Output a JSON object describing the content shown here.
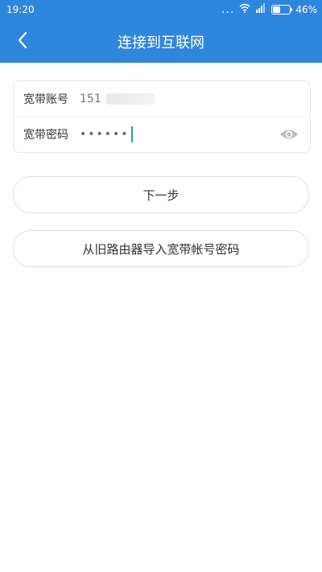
{
  "status_bar": {
    "time": "19:20",
    "battery": "46%",
    "battery_level": 0.46,
    "dots": "..."
  },
  "header": {
    "title": "连接到互联网"
  },
  "form": {
    "account_label": "宽带账号",
    "account_value": "151",
    "password_label": "宽带密码",
    "password_value": "••••••"
  },
  "buttons": {
    "next": "下一步",
    "import": "从旧路由器导入宽带帐号密码"
  },
  "colors": {
    "primary": "#2f86dd",
    "cursor": "#2aa39a"
  },
  "icons": {
    "back": "chevron-left-icon",
    "eye": "eye-icon",
    "wifi": "wifi-icon",
    "signal": "signal-icon",
    "battery": "battery-icon"
  }
}
